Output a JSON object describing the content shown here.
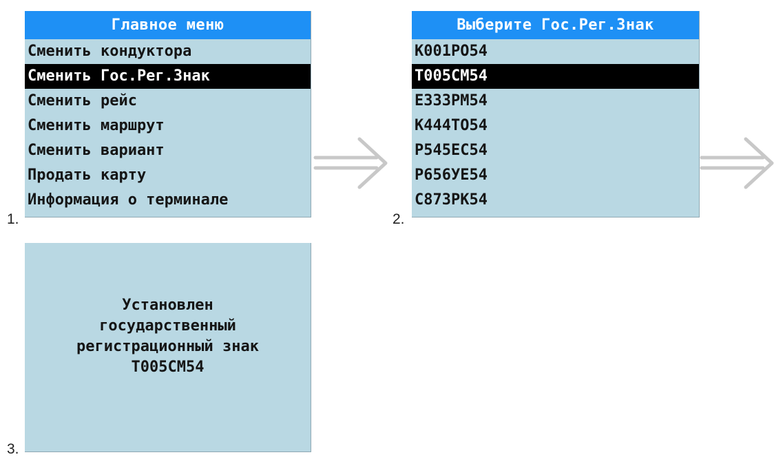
{
  "step_labels": {
    "step1": "1.",
    "step2": "2.",
    "step3": "3."
  },
  "screen1": {
    "header": "Главное меню",
    "items": [
      {
        "label": "Сменить кондуктора",
        "selected": false
      },
      {
        "label": "Сменить Гос.Рег.Знак",
        "selected": true
      },
      {
        "label": "Сменить рейс",
        "selected": false
      },
      {
        "label": "Сменить маршрут",
        "selected": false
      },
      {
        "label": "Сменить вариант",
        "selected": false
      },
      {
        "label": "Продать карту",
        "selected": false
      },
      {
        "label": "Информация о терминале",
        "selected": false
      }
    ]
  },
  "screen2": {
    "header": "Выберите Гос.Рег.Знак",
    "items": [
      {
        "label": "К001РО54",
        "selected": false
      },
      {
        "label": "Т005СМ54",
        "selected": true
      },
      {
        "label": "Е333РМ54",
        "selected": false
      },
      {
        "label": "К444ТО54",
        "selected": false
      },
      {
        "label": "Р545ЕС54",
        "selected": false
      },
      {
        "label": "Р656УЕ54",
        "selected": false
      },
      {
        "label": "С873РК54",
        "selected": false
      }
    ]
  },
  "screen3": {
    "message_lines": [
      "Установлен",
      "государственный",
      "регистрационный знак",
      "Т005СМ54"
    ]
  },
  "colors": {
    "screen_background": "#b9d8e3",
    "header_background": "#1e90f5",
    "header_text": "#ffffff",
    "selection_background": "#000000",
    "selection_text": "#ffffff",
    "arrow": "#c8c8c8"
  },
  "icons": {
    "arrow": "double-line-right-arrow-icon"
  }
}
